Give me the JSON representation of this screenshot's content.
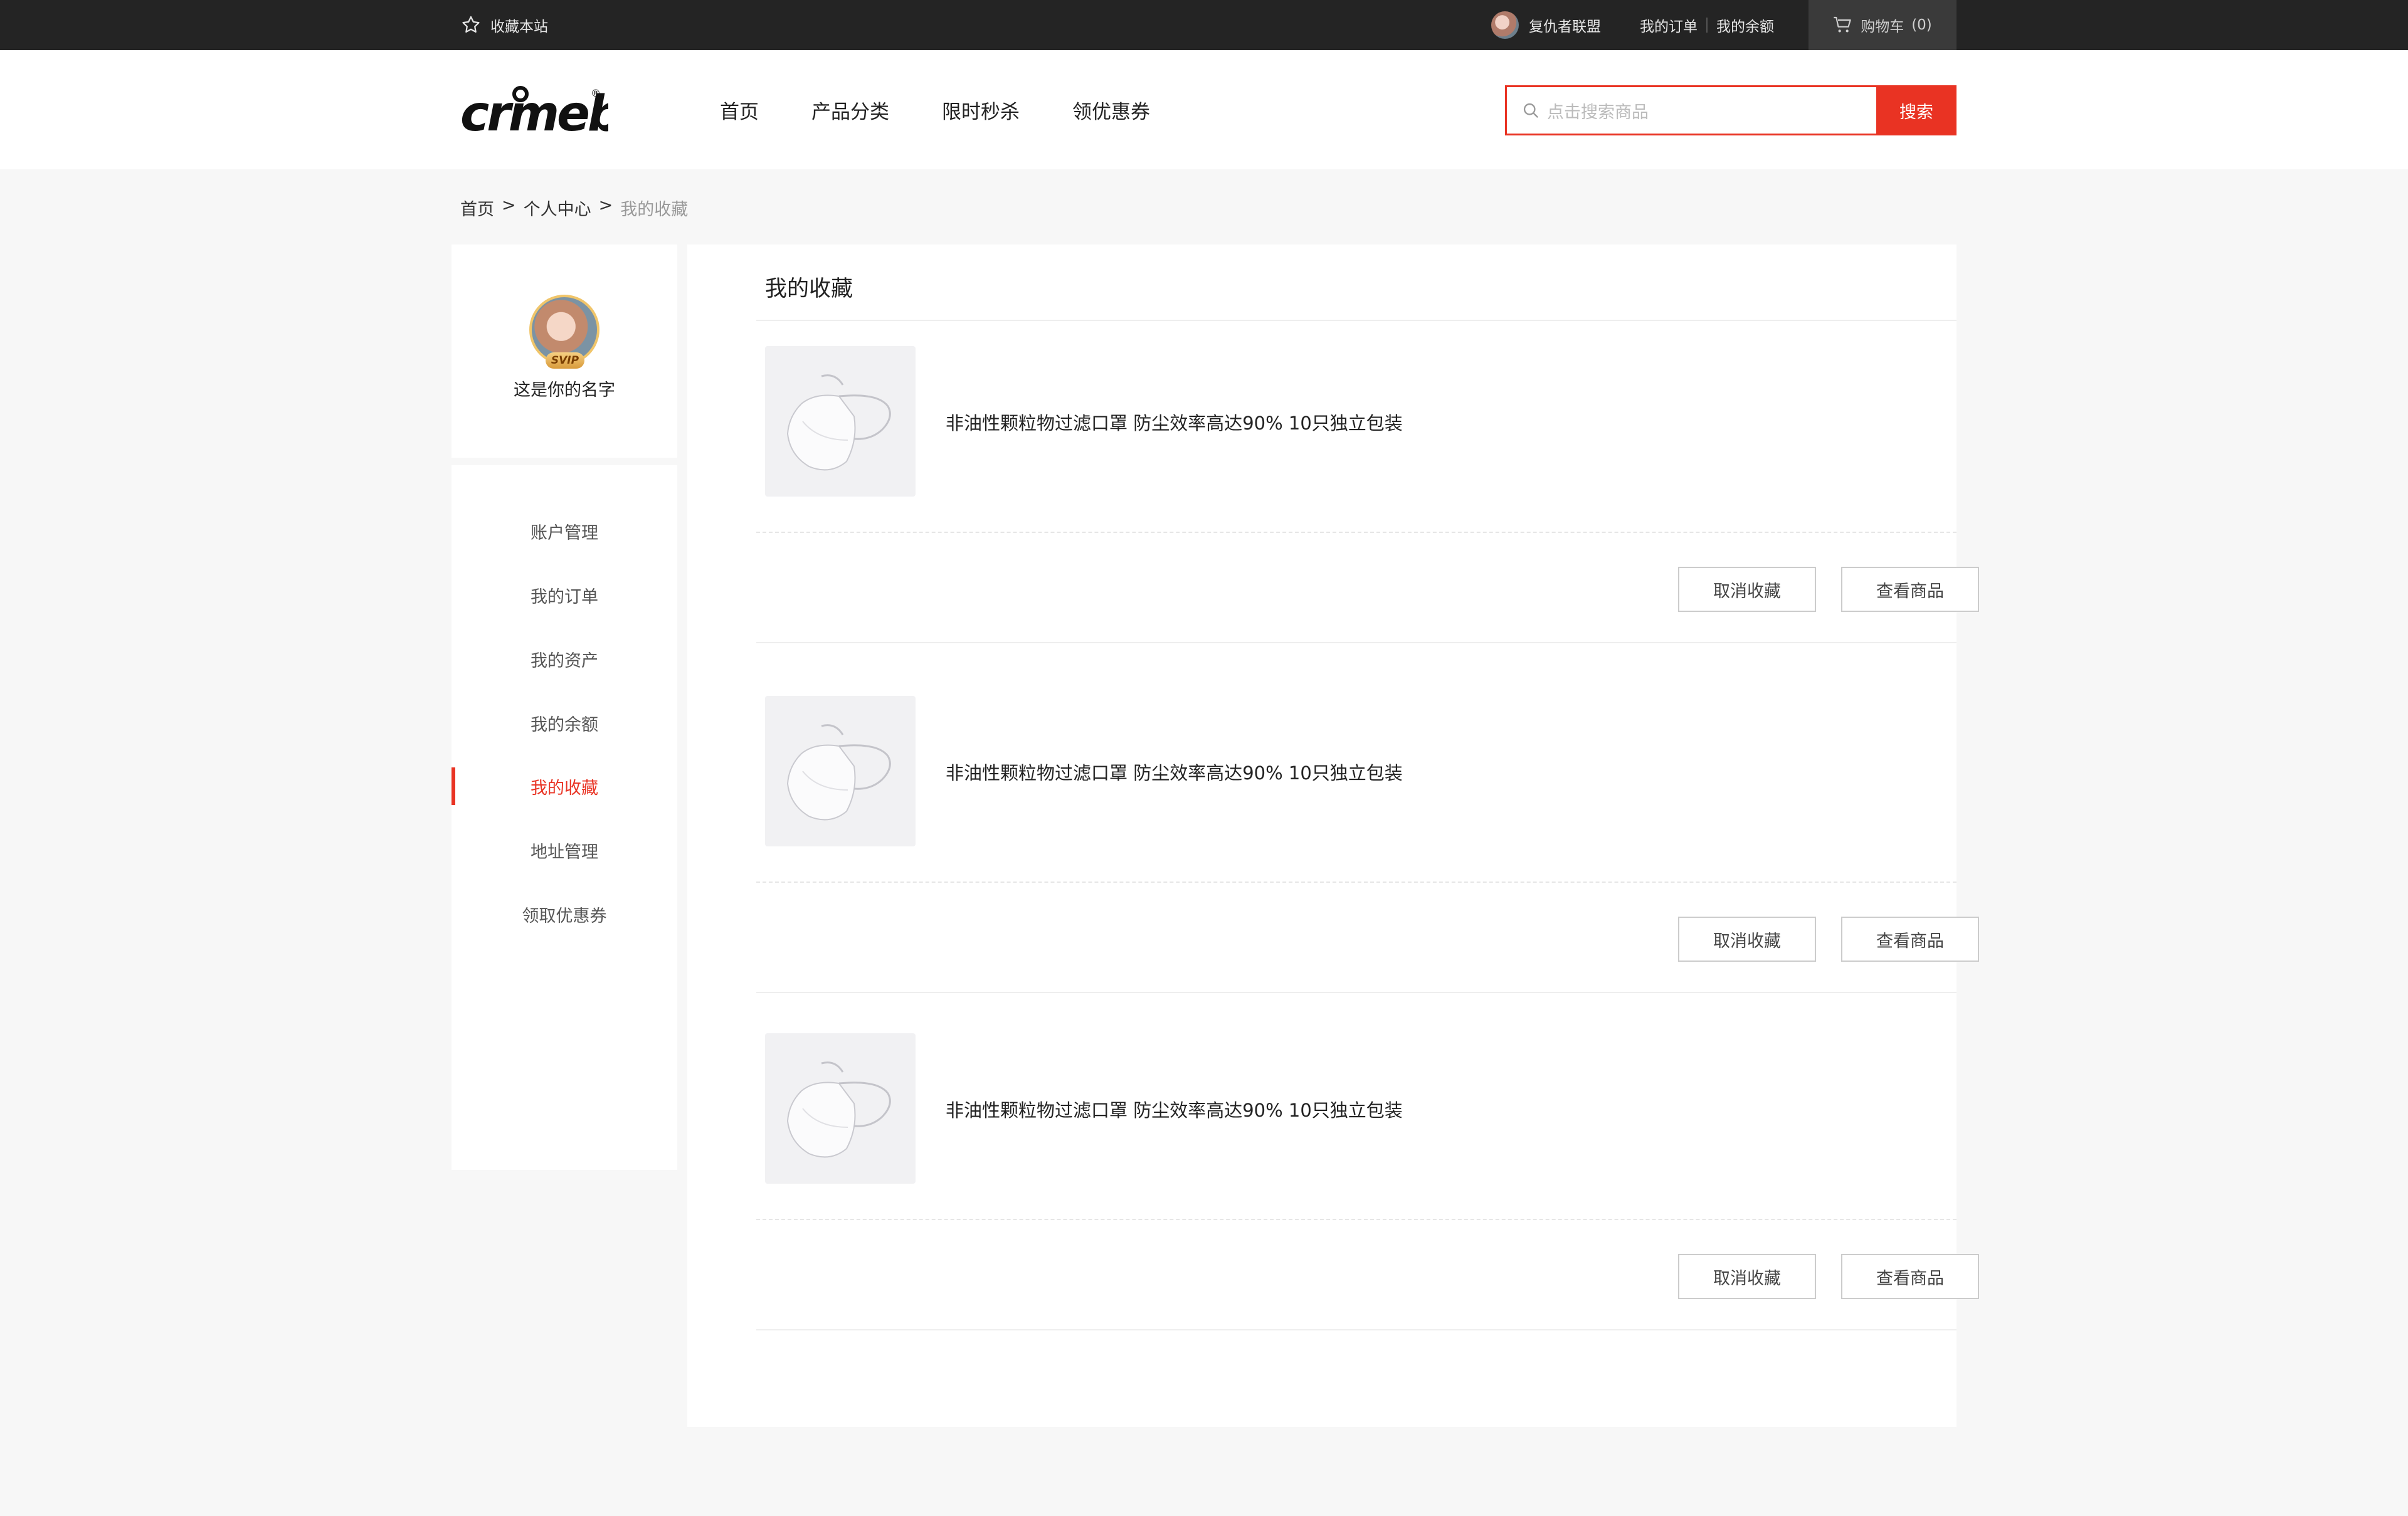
{
  "topbar": {
    "favorite_site": "收藏本站",
    "user_name": "复仇者联盟",
    "my_orders": "我的订单",
    "my_balance": "我的余额",
    "cart_label": "购物车",
    "cart_count": "(0)"
  },
  "header": {
    "nav": [
      "首页",
      "产品分类",
      "限时秒杀",
      "领优惠券"
    ],
    "search_placeholder": "点击搜索商品",
    "search_button": "搜索"
  },
  "breadcrumb": {
    "home": "首页",
    "sep1": ">",
    "center": "个人中心",
    "sep2": ">",
    "current": "我的收藏"
  },
  "profile": {
    "vip_badge": "SVIP",
    "name": "这是你的名字"
  },
  "menu": {
    "items": [
      "账户管理",
      "我的订单",
      "我的资产",
      "我的余额",
      "我的收藏",
      "地址管理",
      "领取优惠券"
    ],
    "active": "我的收藏"
  },
  "main": {
    "title": "我的收藏",
    "items": [
      {
        "name": "非油性颗粒物过滤口罩  防尘效率高达90% 10只独立包装",
        "cancel": "取消收藏",
        "view": "查看商品"
      },
      {
        "name": "非油性颗粒物过滤口罩  防尘效率高达90% 10只独立包装",
        "cancel": "取消收藏",
        "view": "查看商品"
      },
      {
        "name": "非油性颗粒物过滤口罩  防尘效率高达90% 10只独立包装",
        "cancel": "取消收藏",
        "view": "查看商品"
      }
    ]
  },
  "colors": {
    "accent": "#e93323",
    "topbar": "#242424",
    "page_bg": "#f7f7f7"
  }
}
